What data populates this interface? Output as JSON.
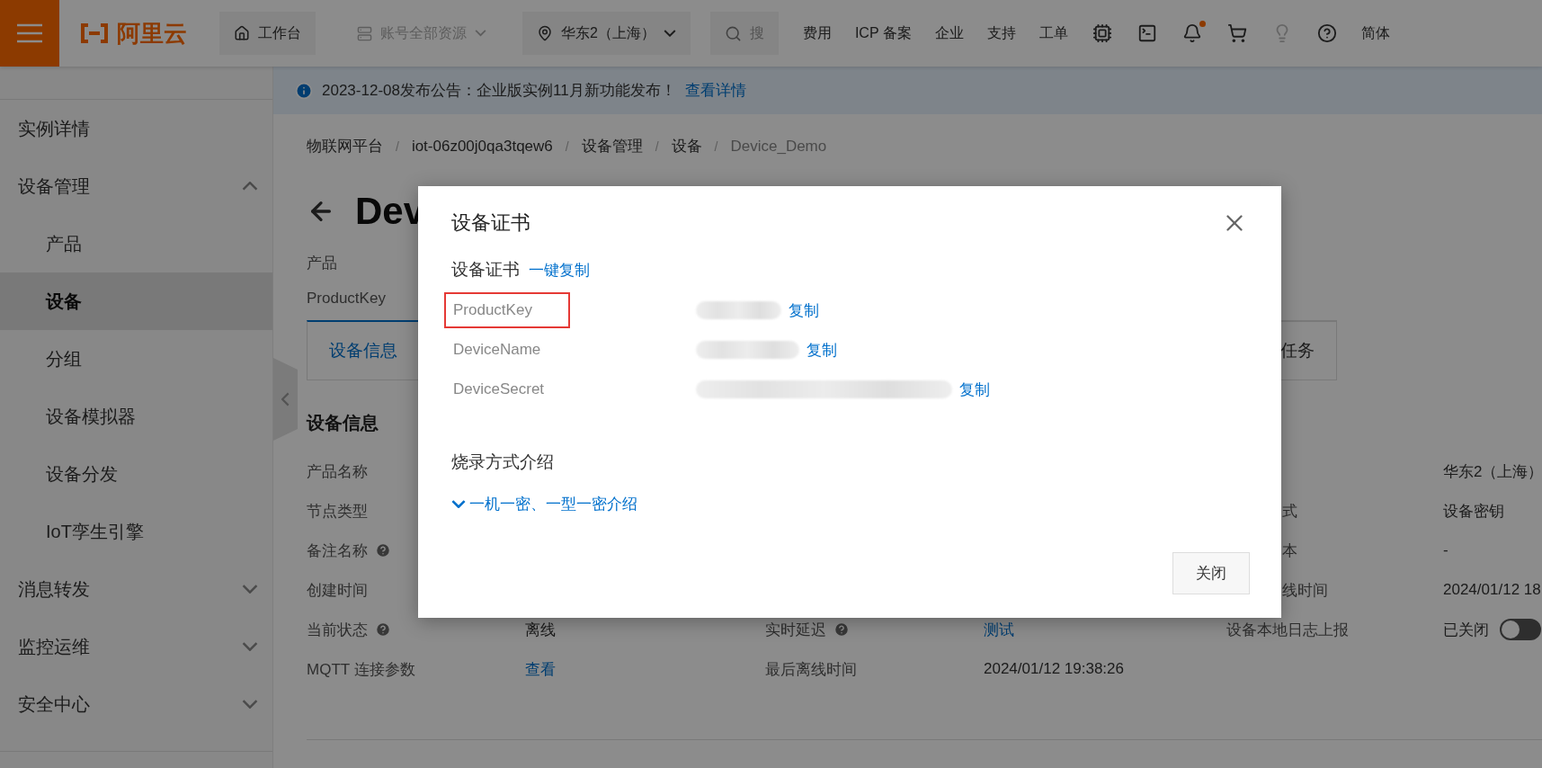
{
  "topbar": {
    "logo": "阿里云",
    "workbench": "工作台",
    "resources": {
      "label": "账号全部资源",
      "disabled": true
    },
    "region": "华东2（上海）",
    "search": {
      "placeholder": "搜"
    },
    "links": [
      "费用",
      "ICP 备案",
      "企业",
      "支持",
      "工单"
    ],
    "bell": {
      "unread": true
    },
    "language": "简体"
  },
  "announcement": {
    "text": "2023-12-08发布公告：企业版实例11月新功能发布！",
    "link": "查看详情"
  },
  "sidebar": {
    "items": [
      {
        "label": "实例详情",
        "selected": false
      },
      {
        "label": "设备管理",
        "selected": false,
        "expanded": true,
        "children": [
          {
            "label": "产品",
            "selected": false
          },
          {
            "label": "设备",
            "selected": true
          },
          {
            "label": "分组",
            "selected": false
          },
          {
            "label": "设备模拟器",
            "selected": false
          },
          {
            "label": "设备分发",
            "selected": false
          },
          {
            "label": "IoT孪生引擎",
            "selected": false
          }
        ]
      },
      {
        "label": "消息转发",
        "selected": false,
        "expanded": false
      },
      {
        "label": "监控运维",
        "selected": false,
        "expanded": false
      },
      {
        "label": "安全中心",
        "selected": false,
        "expanded": false
      }
    ]
  },
  "breadcrumb": {
    "separator": "/",
    "items": [
      "物联网平台",
      "iot-06z00j0qa3tqew6",
      "设备管理",
      "设备",
      "Device_Demo"
    ]
  },
  "page": {
    "title": "Dev",
    "meta": [
      "产品",
      "ProductKey"
    ],
    "tabs": [
      {
        "label": "设备信息",
        "selected": true
      },
      {
        "label": "任务",
        "selected": false
      }
    ],
    "section_title": "设备信息",
    "rows": [
      {
        "cells": [
          {
            "label": "产品名称"
          },
          {},
          {
            "value": "华东2（上海）",
            "kind": "text"
          }
        ]
      },
      {
        "cells": [
          {
            "label": "节点类型"
          },
          {},
          {
            "label": "式",
            "cut": true,
            "value": "设备密钥",
            "kind": "text"
          }
        ]
      },
      {
        "cells": [
          {
            "label": "备注名称",
            "help": true
          },
          {},
          {
            "label": "本",
            "cut": true,
            "value": "-",
            "kind": "text"
          }
        ]
      },
      {
        "cells": [
          {
            "label": "创建时间"
          },
          {},
          {
            "label": "线时间",
            "cut": true,
            "value": "2024/01/12 18",
            "kind": "text"
          }
        ]
      },
      {
        "cells": [
          {
            "label": "当前状态",
            "help": true,
            "value": "离线",
            "kind": "text"
          },
          {
            "label": "实时延迟",
            "help": true,
            "value": "测试",
            "kind": "link"
          },
          {
            "label": "设备本地日志上报",
            "value": "已关闭",
            "kind": "switch",
            "on": false
          }
        ]
      },
      {
        "cells": [
          {
            "label": "MQTT 连接参数",
            "value": "查看",
            "kind": "link"
          },
          {
            "label": "最后离线时间",
            "value": "2024/01/12 19:38:26",
            "kind": "text"
          },
          {}
        ]
      }
    ]
  },
  "dialog": {
    "title": "设备证书",
    "section": "设备证书",
    "copy_all": "一键复制",
    "rows": [
      {
        "label": "ProductKey",
        "highlighted": true,
        "copy": "复制"
      },
      {
        "label": "DeviceName",
        "highlighted": false,
        "copy": "复制"
      },
      {
        "label": "DeviceSecret",
        "highlighted": false,
        "copy": "复制"
      }
    ],
    "burn_title": "烧录方式介绍",
    "burn_link": {
      "label": "一机一密、一型一密介绍",
      "expanded": false
    },
    "close_button": "关闭"
  }
}
